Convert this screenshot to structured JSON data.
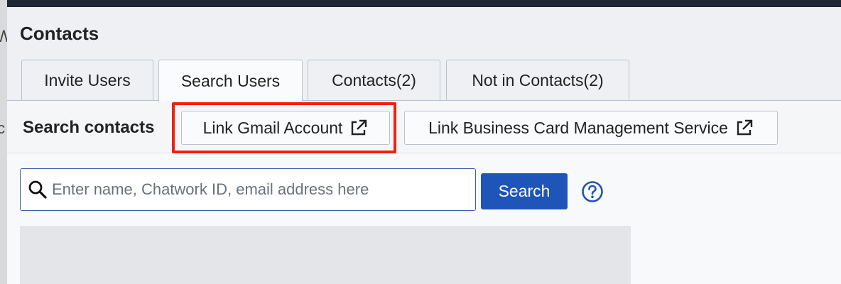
{
  "dialog": {
    "title": "Contacts"
  },
  "tabs": [
    {
      "label": "Invite Users",
      "active": false
    },
    {
      "label": "Search Users",
      "active": true
    },
    {
      "label": "Contacts(2)",
      "active": false
    },
    {
      "label": "Not in Contacts(2)",
      "active": false
    }
  ],
  "search_section": {
    "label": "Search contacts",
    "link_gmail_label": "Link Gmail Account",
    "link_business_card_label": "Link Business Card Management Service",
    "external_link_icon": "external-link-icon",
    "highlight_color": "#f2200e"
  },
  "search": {
    "placeholder": "Enter name, Chatwork ID, email address here",
    "value": "",
    "button_label": "Search",
    "search_icon": "search-icon",
    "help_icon": "help-circle-icon",
    "accent_color": "#1f54b8"
  }
}
